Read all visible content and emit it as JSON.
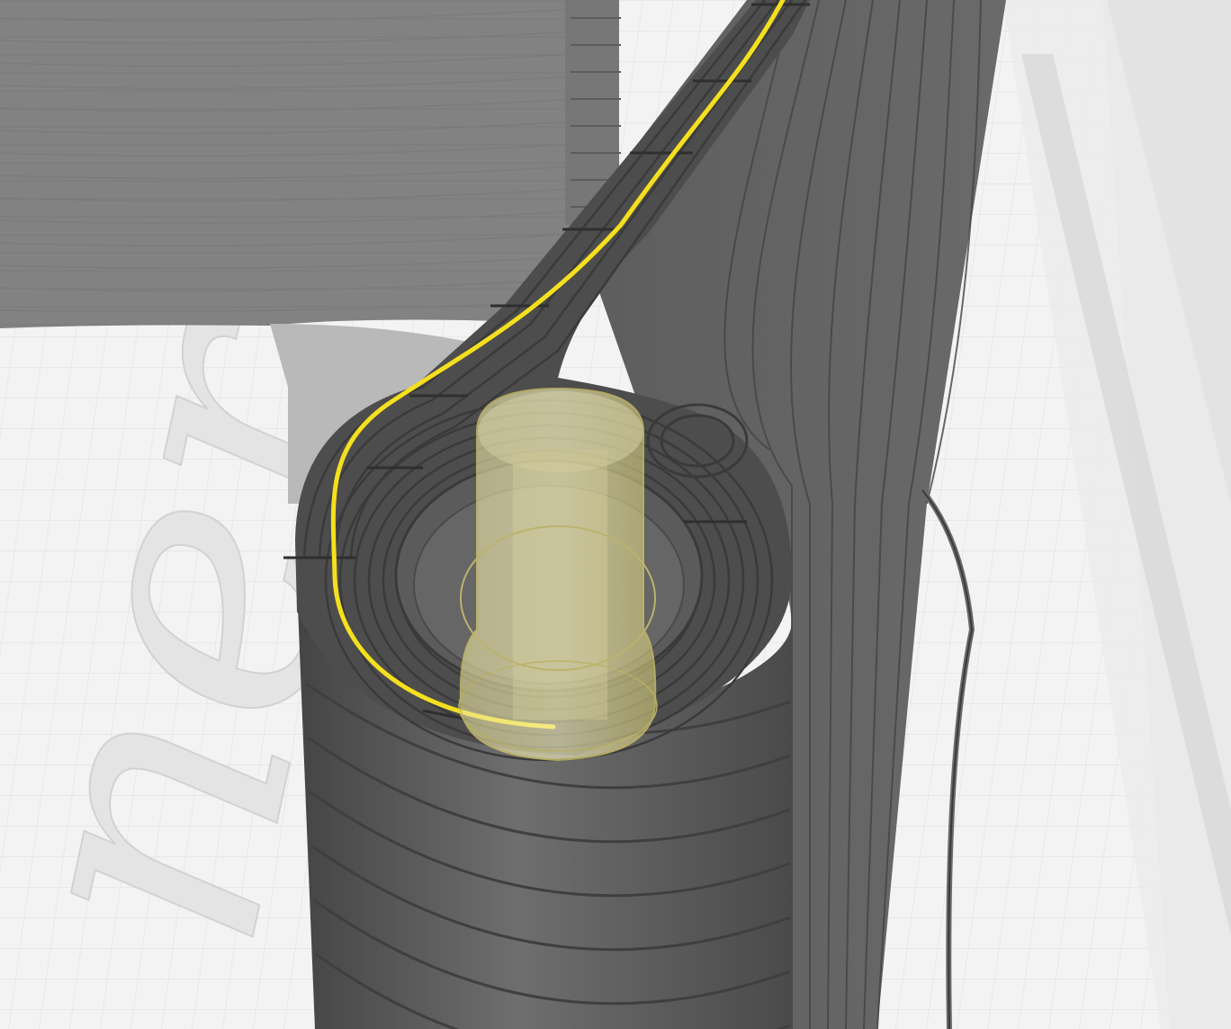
{
  "viewport": {
    "bed_watermark_text": "ner"
  },
  "colors": {
    "bed": "#f4f4f4",
    "bed_grid": "#dadada",
    "bed_border": "#cfcfcf",
    "model_dark": "#5a5a5a",
    "model_mid": "#6c6c6c",
    "model_light": "#a8a8a8",
    "layer_line": "#3a3a3a",
    "toolpath": "#f4e01e",
    "nozzle": "#e8e08a"
  },
  "icons": {
    "nozzle": "nozzle-icon",
    "travel_path": "toolpath-icon"
  }
}
